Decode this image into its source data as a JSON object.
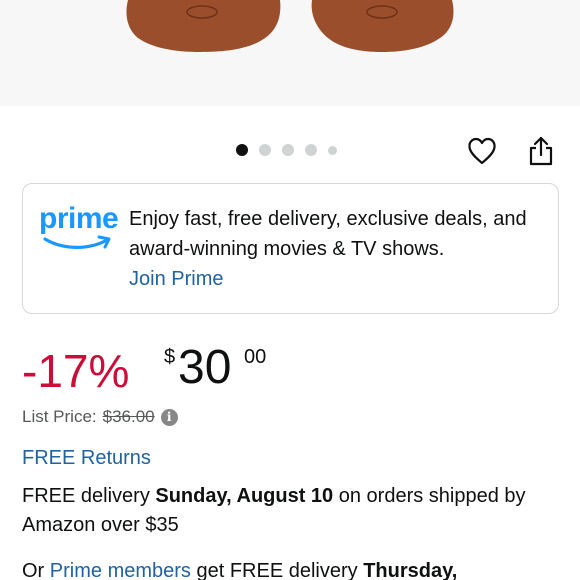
{
  "carousel": {
    "dot_count": 5,
    "active_index": 0
  },
  "actions": {
    "wishlist_icon": "heart-icon",
    "share_icon": "share-icon"
  },
  "prime": {
    "logo_text": "prime",
    "message": "Enjoy fast, free delivery, exclusive deals, and award-winning movies & TV shows.",
    "join_label": "Join Prime",
    "brand_color": "#1a98ff"
  },
  "price": {
    "discount": "-17%",
    "currency": "$",
    "whole": "30",
    "fraction": "00",
    "discount_color": "#cc0c39"
  },
  "list_price": {
    "label": "List Price:",
    "value": "$36.00",
    "info_icon": "info-icon"
  },
  "returns": {
    "label": "FREE Returns"
  },
  "delivery": {
    "prefix": "FREE delivery ",
    "date": "Sunday, August 10",
    "suffix": " on orders shipped by Amazon over $35"
  },
  "prime_delivery": {
    "prefix": "Or ",
    "link": "Prime members",
    "middle": " get FREE delivery ",
    "date": "Thursday,"
  },
  "colors": {
    "link": "#2162a1",
    "text": "#0f1111",
    "muted": "#565959"
  }
}
